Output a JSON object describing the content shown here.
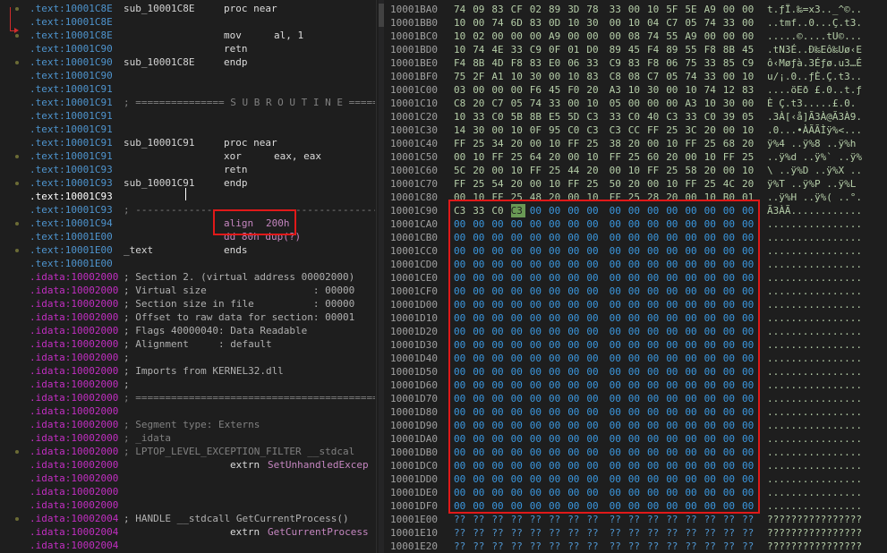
{
  "asm_lines": [
    {
      "seg": "text",
      "addr": ".text:10001C8E",
      "label": "sub_10001C8E",
      "op": "proc near",
      "args": ""
    },
    {
      "seg": "text",
      "addr": ".text:10001C8E",
      "label": "",
      "op": "",
      "args": ""
    },
    {
      "seg": "text",
      "addr": ".text:10001C8E",
      "label": "",
      "op": "mov",
      "args": "al, 1"
    },
    {
      "seg": "text",
      "addr": ".text:10001C90",
      "label": "",
      "op": "retn",
      "args": ""
    },
    {
      "seg": "text",
      "addr": ".text:10001C90",
      "label": "sub_10001C8E",
      "op": "endp",
      "args": ""
    },
    {
      "seg": "text",
      "addr": ".text:10001C90",
      "label": "",
      "op": "",
      "args": ""
    },
    {
      "seg": "text",
      "addr": ".text:10001C91",
      "label": "",
      "op": "",
      "args": ""
    },
    {
      "seg": "text",
      "addr": ".text:10001C91",
      "comment": "; =============== S U B R O U T I N E ======="
    },
    {
      "seg": "text",
      "addr": ".text:10001C91",
      "label": "",
      "op": "",
      "args": ""
    },
    {
      "seg": "text",
      "addr": ".text:10001C91",
      "label": "",
      "op": "",
      "args": ""
    },
    {
      "seg": "text",
      "addr": ".text:10001C91",
      "label": "sub_10001C91",
      "op": "proc near",
      "args": ""
    },
    {
      "seg": "text",
      "addr": ".text:10001C91",
      "label": "",
      "op": "xor",
      "args": "eax, eax"
    },
    {
      "seg": "text",
      "addr": ".text:10001C93",
      "label": "",
      "op": "retn",
      "args": ""
    },
    {
      "seg": "text",
      "addr": ".text:10001C93",
      "label": "sub_10001C91",
      "op": "endp",
      "args": ""
    },
    {
      "seg": "textw",
      "addr": ".text:10001C93",
      "label": "",
      "op": "",
      "args": ""
    },
    {
      "seg": "text",
      "addr": ".text:10001C93",
      "comment": "; ---------------------------------------------"
    },
    {
      "seg": "text",
      "addr": ".text:10001C94",
      "label": "",
      "op": "align",
      "args": "200h"
    },
    {
      "seg": "text",
      "addr": ".text:10001E00",
      "label": "",
      "op": "dd 80h dup(?)",
      "args": ""
    },
    {
      "seg": "text",
      "addr": ".text:10001E00",
      "label": "_text",
      "op": "ends",
      "args": ""
    },
    {
      "seg": "text",
      "addr": ".text:10001E00",
      "label": "",
      "op": "",
      "args": ""
    },
    {
      "seg": "idata",
      "addr": ".idata:10002000",
      "comment2": "; Section 2. (virtual address 00002000)"
    },
    {
      "seg": "idata",
      "addr": ".idata:10002000",
      "comment2": "; Virtual size                  : 00000"
    },
    {
      "seg": "idata",
      "addr": ".idata:10002000",
      "comment2": "; Section size in file          : 00000"
    },
    {
      "seg": "idata",
      "addr": ".idata:10002000",
      "comment2": "; Offset to raw data for section: 00001"
    },
    {
      "seg": "idata",
      "addr": ".idata:10002000",
      "comment2": "; Flags 40000040: Data Readable"
    },
    {
      "seg": "idata",
      "addr": ".idata:10002000",
      "comment2": "; Alignment     : default"
    },
    {
      "seg": "idata",
      "addr": ".idata:10002000",
      "comment2": ";"
    },
    {
      "seg": "idata",
      "addr": ".idata:10002000",
      "comment2": "; Imports from KERNEL32.dll"
    },
    {
      "seg": "idata",
      "addr": ".idata:10002000",
      "comment2": ";"
    },
    {
      "seg": "idata",
      "addr": ".idata:10002000",
      "comment": "; ============================================"
    },
    {
      "seg": "idata",
      "addr": ".idata:10002000",
      "label": "",
      "op": "",
      "args": ""
    },
    {
      "seg": "idata",
      "addr": ".idata:10002000",
      "comment": "; Segment type: Externs"
    },
    {
      "seg": "idata",
      "addr": ".idata:10002000",
      "comment": "; _idata"
    },
    {
      "seg": "idata",
      "addr": ".idata:10002000",
      "comment": "; LPTOP_LEVEL_EXCEPTION_FILTER __stdcal"
    },
    {
      "seg": "idata",
      "addr": ".idata:10002000",
      "extrn": "extrn",
      "sym": "SetUnhandledExcep"
    },
    {
      "seg": "idata",
      "addr": ".idata:10002000",
      "label": "",
      "op": "",
      "args": ""
    },
    {
      "seg": "idata",
      "addr": ".idata:10002000",
      "label": "",
      "op": "",
      "args": ""
    },
    {
      "seg": "idata",
      "addr": ".idata:10002000",
      "label": "",
      "op": "",
      "args": ""
    },
    {
      "seg": "idata",
      "addr": ".idata:10002004",
      "comment2": "; HANDLE __stdcall GetCurrentProcess()"
    },
    {
      "seg": "idata",
      "addr": ".idata:10002004",
      "extrn": "extrn",
      "sym": "GetCurrentProcess"
    },
    {
      "seg": "idata",
      "addr": ".idata:10002004",
      "label": "",
      "op": "",
      "args": ""
    }
  ],
  "hex_rows": [
    {
      "addr": "10001BA0",
      "bytes": [
        "74",
        "09",
        "83",
        "CF",
        "02",
        "89",
        "3D",
        "78",
        "33",
        "00",
        "10",
        "5F",
        "5E",
        "A9",
        "00",
        "00"
      ],
      "ascii": "t.ƒÏ.‰=x3.._^©.."
    },
    {
      "addr": "10001BB0",
      "bytes": [
        "10",
        "00",
        "74",
        "6D",
        "83",
        "0D",
        "10",
        "30",
        "00",
        "10",
        "04",
        "C7",
        "05",
        "74",
        "33",
        "00"
      ],
      "ascii": "..tmf..0...Ç.t3."
    },
    {
      "addr": "10001BC0",
      "bytes": [
        "10",
        "02",
        "00",
        "00",
        "00",
        "A9",
        "00",
        "00",
        "00",
        "08",
        "74",
        "55",
        "A9",
        "00",
        "00",
        "00"
      ],
      "ascii": ".....©....tU©..."
    },
    {
      "addr": "10001BD0",
      "bytes": [
        "10",
        "74",
        "4E",
        "33",
        "C9",
        "0F",
        "01",
        "D0",
        "89",
        "45",
        "F4",
        "89",
        "55",
        "F8",
        "8B",
        "45"
      ],
      "ascii": ".tN3É..Ð‰Eô‰Uø‹E"
    },
    {
      "addr": "10001BE0",
      "bytes": [
        "F4",
        "8B",
        "4D",
        "F8",
        "83",
        "E0",
        "06",
        "33",
        "C9",
        "83",
        "F8",
        "06",
        "75",
        "33",
        "85",
        "C9"
      ],
      "ascii": "ô‹Møƒà.3Éƒø.u3…É"
    },
    {
      "addr": "10001BF0",
      "bytes": [
        "75",
        "2F",
        "A1",
        "10",
        "30",
        "00",
        "10",
        "83",
        "C8",
        "08",
        "C7",
        "05",
        "74",
        "33",
        "00",
        "10"
      ],
      "ascii": "u/¡.0..ƒÈ.Ç.t3.."
    },
    {
      "addr": "10001C00",
      "bytes": [
        "03",
        "00",
        "00",
        "00",
        "F6",
        "45",
        "F0",
        "20",
        "A3",
        "10",
        "30",
        "00",
        "10",
        "74",
        "12",
        "83"
      ],
      "ascii": "....öEð £.0..t.ƒ"
    },
    {
      "addr": "10001C10",
      "bytes": [
        "C8",
        "20",
        "C7",
        "05",
        "74",
        "33",
        "00",
        "10",
        "05",
        "00",
        "00",
        "00",
        "A3",
        "10",
        "30",
        "00"
      ],
      "ascii": "È Ç.t3.....£.0."
    },
    {
      "addr": "10001C20",
      "bytes": [
        "10",
        "33",
        "C0",
        "5B",
        "8B",
        "E5",
        "5D",
        "C3",
        "33",
        "C0",
        "40",
        "C3",
        "33",
        "C0",
        "39",
        "05"
      ],
      "ascii": ".3À[‹å]Ã3À@Ã3À9."
    },
    {
      "addr": "10001C30",
      "bytes": [
        "14",
        "30",
        "00",
        "10",
        "0F",
        "95",
        "C0",
        "C3",
        "C3",
        "CC",
        "FF",
        "25",
        "3C",
        "20",
        "00",
        "10"
      ],
      "ascii": ".0...•ÀÃÃÌÿ%<..."
    },
    {
      "addr": "10001C40",
      "bytes": [
        "FF",
        "25",
        "34",
        "20",
        "00",
        "10",
        "FF",
        "25",
        "38",
        "20",
        "00",
        "10",
        "FF",
        "25",
        "68",
        "20"
      ],
      "ascii": "ÿ%4 ..ÿ%8 ..ÿ%h "
    },
    {
      "addr": "10001C50",
      "bytes": [
        "00",
        "10",
        "FF",
        "25",
        "64",
        "20",
        "00",
        "10",
        "FF",
        "25",
        "60",
        "20",
        "00",
        "10",
        "FF",
        "25"
      ],
      "ascii": "..ÿ%d ..ÿ%` ..ÿ%"
    },
    {
      "addr": "10001C60",
      "bytes": [
        "5C",
        "20",
        "00",
        "10",
        "FF",
        "25",
        "44",
        "20",
        "00",
        "10",
        "FF",
        "25",
        "58",
        "20",
        "00",
        "10"
      ],
      "ascii": "\\ ..ÿ%D ..ÿ%X .."
    },
    {
      "addr": "10001C70",
      "bytes": [
        "FF",
        "25",
        "54",
        "20",
        "00",
        "10",
        "FF",
        "25",
        "50",
        "20",
        "00",
        "10",
        "FF",
        "25",
        "4C",
        "20"
      ],
      "ascii": "ÿ%T ..ÿ%P ..ÿ%L "
    },
    {
      "addr": "10001C80",
      "bytes": [
        "00",
        "10",
        "FF",
        "25",
        "48",
        "20",
        "00",
        "10",
        "FF",
        "25",
        "28",
        "20",
        "00",
        "10",
        "B0",
        "01"
      ],
      "ascii": "..ÿ%H ..ÿ%( ..°."
    },
    {
      "addr": "10001C90",
      "bytes": [
        "C3",
        "33",
        "C0",
        "C3",
        "00",
        "00",
        "00",
        "00",
        "00",
        "00",
        "00",
        "00",
        "00",
        "00",
        "00",
        "00"
      ],
      "ascii": "Ã3ÀÃ............"
    },
    {
      "addr": "10001CA0",
      "bytes": [
        "00",
        "00",
        "00",
        "00",
        "00",
        "00",
        "00",
        "00",
        "00",
        "00",
        "00",
        "00",
        "00",
        "00",
        "00",
        "00"
      ],
      "ascii": "................"
    },
    {
      "addr": "10001CB0",
      "bytes": [
        "00",
        "00",
        "00",
        "00",
        "00",
        "00",
        "00",
        "00",
        "00",
        "00",
        "00",
        "00",
        "00",
        "00",
        "00",
        "00"
      ],
      "ascii": "................"
    },
    {
      "addr": "10001CC0",
      "bytes": [
        "00",
        "00",
        "00",
        "00",
        "00",
        "00",
        "00",
        "00",
        "00",
        "00",
        "00",
        "00",
        "00",
        "00",
        "00",
        "00"
      ],
      "ascii": "................"
    },
    {
      "addr": "10001CD0",
      "bytes": [
        "00",
        "00",
        "00",
        "00",
        "00",
        "00",
        "00",
        "00",
        "00",
        "00",
        "00",
        "00",
        "00",
        "00",
        "00",
        "00"
      ],
      "ascii": "................"
    },
    {
      "addr": "10001CE0",
      "bytes": [
        "00",
        "00",
        "00",
        "00",
        "00",
        "00",
        "00",
        "00",
        "00",
        "00",
        "00",
        "00",
        "00",
        "00",
        "00",
        "00"
      ],
      "ascii": "................"
    },
    {
      "addr": "10001CF0",
      "bytes": [
        "00",
        "00",
        "00",
        "00",
        "00",
        "00",
        "00",
        "00",
        "00",
        "00",
        "00",
        "00",
        "00",
        "00",
        "00",
        "00"
      ],
      "ascii": "................"
    },
    {
      "addr": "10001D00",
      "bytes": [
        "00",
        "00",
        "00",
        "00",
        "00",
        "00",
        "00",
        "00",
        "00",
        "00",
        "00",
        "00",
        "00",
        "00",
        "00",
        "00"
      ],
      "ascii": "................"
    },
    {
      "addr": "10001D10",
      "bytes": [
        "00",
        "00",
        "00",
        "00",
        "00",
        "00",
        "00",
        "00",
        "00",
        "00",
        "00",
        "00",
        "00",
        "00",
        "00",
        "00"
      ],
      "ascii": "................"
    },
    {
      "addr": "10001D20",
      "bytes": [
        "00",
        "00",
        "00",
        "00",
        "00",
        "00",
        "00",
        "00",
        "00",
        "00",
        "00",
        "00",
        "00",
        "00",
        "00",
        "00"
      ],
      "ascii": "................"
    },
    {
      "addr": "10001D30",
      "bytes": [
        "00",
        "00",
        "00",
        "00",
        "00",
        "00",
        "00",
        "00",
        "00",
        "00",
        "00",
        "00",
        "00",
        "00",
        "00",
        "00"
      ],
      "ascii": "................"
    },
    {
      "addr": "10001D40",
      "bytes": [
        "00",
        "00",
        "00",
        "00",
        "00",
        "00",
        "00",
        "00",
        "00",
        "00",
        "00",
        "00",
        "00",
        "00",
        "00",
        "00"
      ],
      "ascii": "................"
    },
    {
      "addr": "10001D50",
      "bytes": [
        "00",
        "00",
        "00",
        "00",
        "00",
        "00",
        "00",
        "00",
        "00",
        "00",
        "00",
        "00",
        "00",
        "00",
        "00",
        "00"
      ],
      "ascii": "................"
    },
    {
      "addr": "10001D60",
      "bytes": [
        "00",
        "00",
        "00",
        "00",
        "00",
        "00",
        "00",
        "00",
        "00",
        "00",
        "00",
        "00",
        "00",
        "00",
        "00",
        "00"
      ],
      "ascii": "................"
    },
    {
      "addr": "10001D70",
      "bytes": [
        "00",
        "00",
        "00",
        "00",
        "00",
        "00",
        "00",
        "00",
        "00",
        "00",
        "00",
        "00",
        "00",
        "00",
        "00",
        "00"
      ],
      "ascii": "................"
    },
    {
      "addr": "10001D80",
      "bytes": [
        "00",
        "00",
        "00",
        "00",
        "00",
        "00",
        "00",
        "00",
        "00",
        "00",
        "00",
        "00",
        "00",
        "00",
        "00",
        "00"
      ],
      "ascii": "................"
    },
    {
      "addr": "10001D90",
      "bytes": [
        "00",
        "00",
        "00",
        "00",
        "00",
        "00",
        "00",
        "00",
        "00",
        "00",
        "00",
        "00",
        "00",
        "00",
        "00",
        "00"
      ],
      "ascii": "................"
    },
    {
      "addr": "10001DA0",
      "bytes": [
        "00",
        "00",
        "00",
        "00",
        "00",
        "00",
        "00",
        "00",
        "00",
        "00",
        "00",
        "00",
        "00",
        "00",
        "00",
        "00"
      ],
      "ascii": "................"
    },
    {
      "addr": "10001DB0",
      "bytes": [
        "00",
        "00",
        "00",
        "00",
        "00",
        "00",
        "00",
        "00",
        "00",
        "00",
        "00",
        "00",
        "00",
        "00",
        "00",
        "00"
      ],
      "ascii": "................"
    },
    {
      "addr": "10001DC0",
      "bytes": [
        "00",
        "00",
        "00",
        "00",
        "00",
        "00",
        "00",
        "00",
        "00",
        "00",
        "00",
        "00",
        "00",
        "00",
        "00",
        "00"
      ],
      "ascii": "................"
    },
    {
      "addr": "10001DD0",
      "bytes": [
        "00",
        "00",
        "00",
        "00",
        "00",
        "00",
        "00",
        "00",
        "00",
        "00",
        "00",
        "00",
        "00",
        "00",
        "00",
        "00"
      ],
      "ascii": "................"
    },
    {
      "addr": "10001DE0",
      "bytes": [
        "00",
        "00",
        "00",
        "00",
        "00",
        "00",
        "00",
        "00",
        "00",
        "00",
        "00",
        "00",
        "00",
        "00",
        "00",
        "00"
      ],
      "ascii": "................"
    },
    {
      "addr": "10001DF0",
      "bytes": [
        "00",
        "00",
        "00",
        "00",
        "00",
        "00",
        "00",
        "00",
        "00",
        "00",
        "00",
        "00",
        "00",
        "00",
        "00",
        "00"
      ],
      "ascii": "................"
    },
    {
      "addr": "10001E00",
      "bytes": [
        "??",
        "??",
        "??",
        "??",
        "??",
        "??",
        "??",
        "??",
        "??",
        "??",
        "??",
        "??",
        "??",
        "??",
        "??",
        "??"
      ],
      "ascii": "????????????????"
    },
    {
      "addr": "10001E10",
      "bytes": [
        "??",
        "??",
        "??",
        "??",
        "??",
        "??",
        "??",
        "??",
        "??",
        "??",
        "??",
        "??",
        "??",
        "??",
        "??",
        "??"
      ],
      "ascii": "????????????????"
    },
    {
      "addr": "10001E20",
      "bytes": [
        "??",
        "??",
        "??",
        "??",
        "??",
        "??",
        "??",
        "??",
        "??",
        "??",
        "??",
        "??",
        "??",
        "??",
        "??",
        "??"
      ],
      "ascii": "????????????????"
    }
  ],
  "colors": {
    "highlight": "#e01919",
    "text_seg": "#4e94ce",
    "idata_seg": "#c12ec1",
    "hex_old": "#b5cea8",
    "hex_new": "#3a96dd"
  }
}
